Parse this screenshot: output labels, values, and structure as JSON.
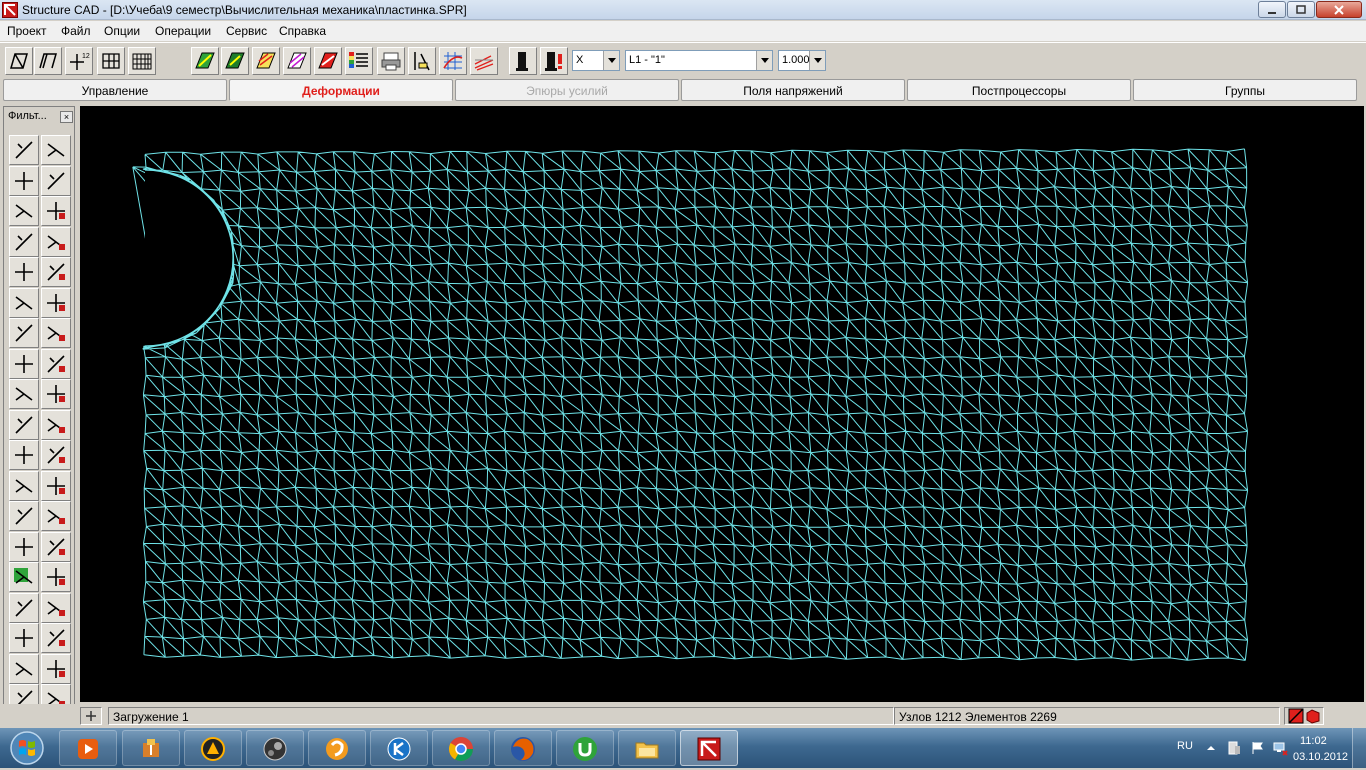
{
  "window": {
    "app_name": "Structure CAD",
    "title": "Structure CAD  - [D:\\Учеба\\9 семестр\\Вычислительная механика\\пластинка.SPR]"
  },
  "menu": [
    "Проект",
    "Файл",
    "Опции",
    "Операции",
    "Сервис",
    "Справка"
  ],
  "toolbar": {
    "combo_axis": "X",
    "combo_load": "L1 - \"1\"",
    "combo_scale": "1.000"
  },
  "tabs": [
    {
      "label": "Управление",
      "state": "normal"
    },
    {
      "label": "Деформации",
      "state": "active"
    },
    {
      "label": "Эпюры усилий",
      "state": "disabled"
    },
    {
      "label": "Поля напряжений",
      "state": "normal"
    },
    {
      "label": "Постпроцессоры",
      "state": "normal"
    },
    {
      "label": "Группы",
      "state": "normal"
    }
  ],
  "filters_panel": {
    "title": "Фильт...",
    "close_symbol": "×"
  },
  "model_view": {
    "background_color": "#000000",
    "mesh_color": "#6fe3e8",
    "undeformed_color": "#5ad0d4"
  },
  "status": {
    "load_case": "Загружение 1",
    "counts": "Узлов 1212 Элементов 2269"
  },
  "taskbar": {
    "language": "RU",
    "time": "11:02",
    "date": "03.10.2012"
  }
}
